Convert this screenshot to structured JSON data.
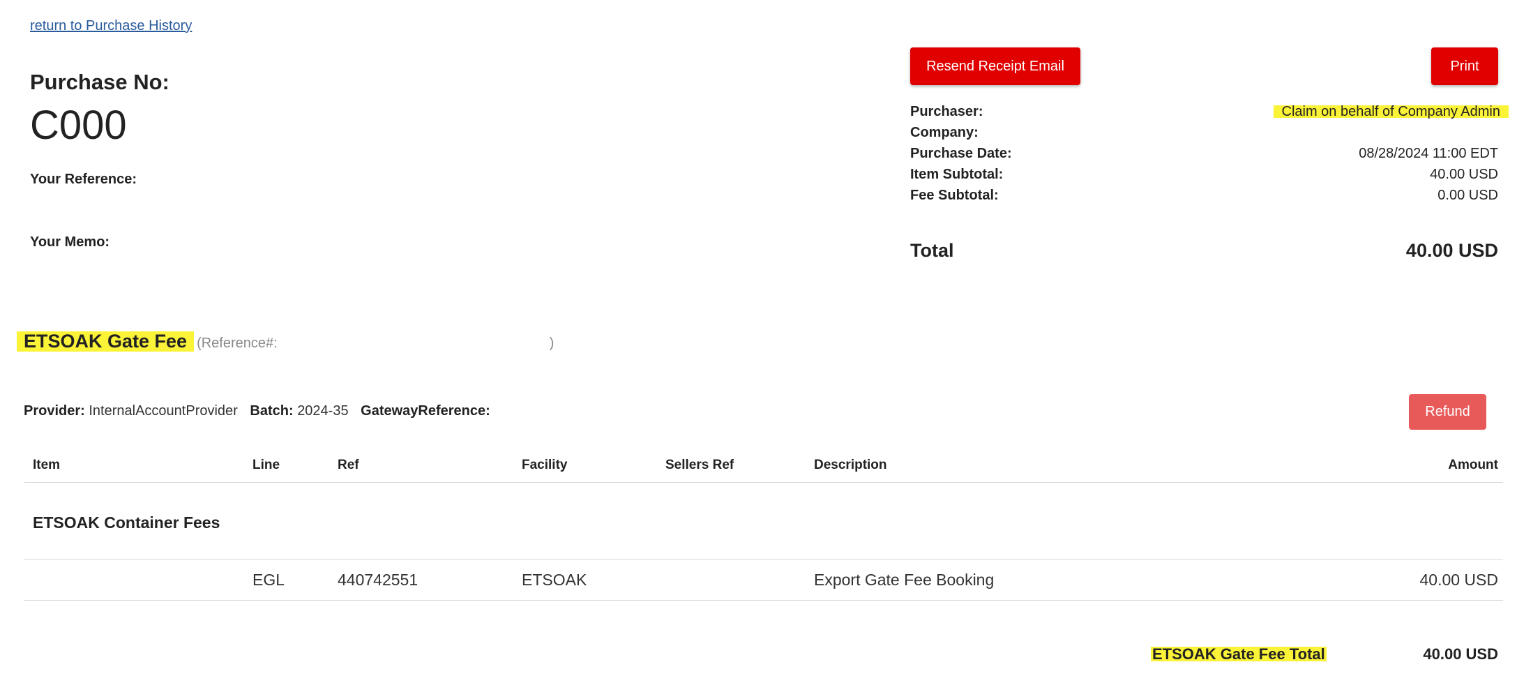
{
  "nav": {
    "back_link": "return to Purchase History"
  },
  "purchase": {
    "no_label": "Purchase No:",
    "no_value": "C000",
    "your_reference_label": "Your Reference:",
    "your_memo_label": "Your Memo:"
  },
  "actions": {
    "resend_label": "Resend Receipt Email",
    "print_label": "Print",
    "refund_label": "Refund"
  },
  "summary": {
    "purchaser_label": "Purchaser:",
    "purchaser_value": "Claim on behalf of Company Admin",
    "company_label": "Company:",
    "purchase_date_label": "Purchase Date:",
    "purchase_date_value": "08/28/2024 11:00 EDT",
    "item_subtotal_label": "Item Subtotal:",
    "item_subtotal_value": "40.00 USD",
    "fee_subtotal_label": "Fee Subtotal:",
    "fee_subtotal_value": "0.00 USD",
    "total_label": "Total",
    "total_value": "40.00 USD"
  },
  "section": {
    "title": "ETSOAK Gate Fee",
    "reference_label": "(Reference#:",
    "reference_close": ")",
    "provider_label": "Provider:",
    "provider_value": "InternalAccountProvider",
    "batch_label": "Batch:",
    "batch_value": "2024-35",
    "gateway_label": "GatewayReference:"
  },
  "table": {
    "headers": [
      "Item",
      "Line",
      "Ref",
      "Facility",
      "Sellers Ref",
      "Description",
      "Amount"
    ],
    "group_title": "ETSOAK Container Fees",
    "rows": [
      {
        "item": "",
        "line": "EGL",
        "ref": "440742551",
        "facility": "ETSOAK",
        "sellers_ref": "",
        "description": "Export Gate Fee Booking",
        "amount": "40.00 USD"
      }
    ]
  },
  "fee_total": {
    "label": "ETSOAK Gate Fee Total",
    "value": "40.00 USD"
  },
  "colors": {
    "primary_red": "#e00000",
    "refund_red": "#e85a5a",
    "highlight": "#fbf338",
    "link": "#2a5b9c"
  }
}
